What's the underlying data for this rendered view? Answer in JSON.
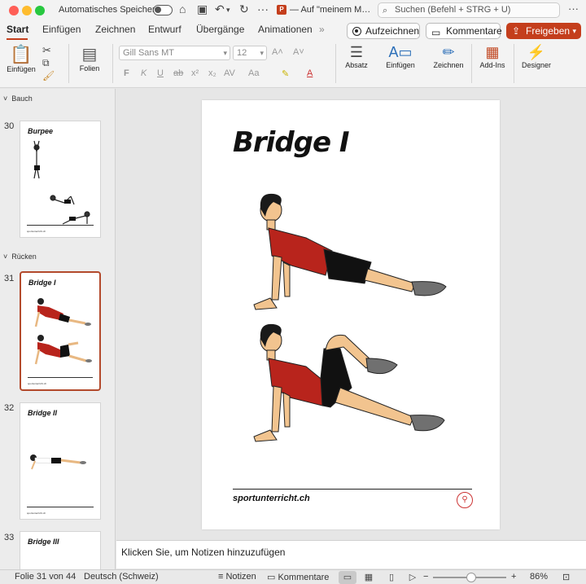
{
  "titlebar": {
    "autosave_label": "Automatisches Speichern",
    "document_title": "— Auf \"meinem M…",
    "search_placeholder": "Suchen (Befehl + STRG + U)"
  },
  "tabs": [
    "Start",
    "Einfügen",
    "Zeichnen",
    "Entwurf",
    "Übergänge",
    "Animationen",
    "»"
  ],
  "actions": {
    "record": "Aufzeichnen",
    "comments": "Kommentare",
    "share": "Freigeben"
  },
  "ribbon": {
    "paste": "Einfügen",
    "slides": "Folien",
    "font_name": "Gill Sans MT",
    "font_size": "12",
    "paragraph": "Absatz",
    "insert": "Einfügen",
    "draw": "Zeichnen",
    "addins": "Add-Ins",
    "designer": "Designer"
  },
  "panel": {
    "sections": [
      "Bauch",
      "Rücken"
    ],
    "slides": [
      {
        "number": "30",
        "title": "Burpee"
      },
      {
        "number": "31",
        "title": "Bridge I"
      },
      {
        "number": "32",
        "title": "Bridge II"
      },
      {
        "number": "33",
        "title": "Bridge III"
      }
    ],
    "thumb_footer": "sportunterricht.ch"
  },
  "slide": {
    "title": "Bridge I",
    "footer": "sportunterricht.ch"
  },
  "notes_placeholder": "Klicken Sie, um Notizen hinzuzufügen",
  "status": {
    "slide_count": "Folie 31 von 44",
    "language": "Deutsch (Schweiz)",
    "notes": "Notizen",
    "comments": "Kommentare",
    "zoom": "86%"
  },
  "colors": {
    "accent": "#c43e1c",
    "selection_border": "#b34a2c",
    "shirt": "#b8241c",
    "shorts": "#111111",
    "skin": "#f2c48f",
    "shoe": "#707070"
  }
}
